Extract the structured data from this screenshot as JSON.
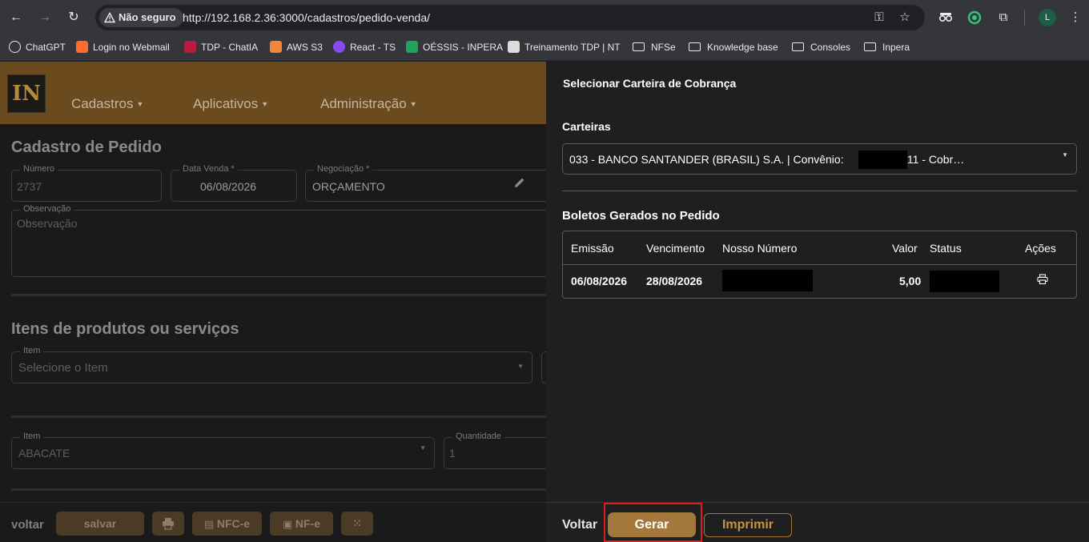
{
  "browser": {
    "security_label": "Não seguro",
    "url": "http://192.168.2.36:3000/cadastros/pedido-venda/",
    "profile_initial": "L",
    "bookmarks": [
      {
        "label": "ChatGPT",
        "icon": "chatgpt-icon",
        "color": "#e8eaed"
      },
      {
        "label": "Login no Webmail",
        "icon": "cpanel-icon",
        "color": "#ff6c2c"
      },
      {
        "label": "TDP - ChatIA",
        "icon": "tdp-icon",
        "color": "#b91c3c"
      },
      {
        "label": "AWS S3",
        "icon": "aws-icon",
        "color": "#f58536"
      },
      {
        "label": "React - TS",
        "icon": "react-icon",
        "color": "#8a4af3"
      },
      {
        "label": "OÉSSIS - INPERA",
        "icon": "oessis-icon",
        "color": "#1fa35a"
      },
      {
        "label": "Treinamento TDP | NT",
        "icon": "doc-icon",
        "color": "#dcdcdc"
      },
      {
        "label": "NFSe",
        "icon": "folder-icon"
      },
      {
        "label": "Knowledge base",
        "icon": "folder-icon"
      },
      {
        "label": "Consoles",
        "icon": "folder-icon"
      },
      {
        "label": "Inpera",
        "icon": "folder-icon"
      }
    ]
  },
  "app": {
    "logo_text": "IN",
    "menu": [
      "Cadastros",
      "Aplicativos",
      "Administração"
    ],
    "page_title": "Cadastro de Pedido",
    "fields": {
      "numero_label": "Número",
      "numero_value": "2737",
      "data_venda_label": "Data Venda *",
      "data_venda_value": "06/08/2026",
      "negociacao_label": "Negociação *",
      "negociacao_value": "ORÇAMENTO",
      "observacao_label": "Observação",
      "observacao_placeholder": "Observação"
    },
    "items_section_title": "Itens de produtos ou serviços",
    "item_select_label": "Item",
    "item_select_placeholder": "Selecione o Item",
    "item_row": {
      "item_label": "Item",
      "item_value": "ABACATE",
      "qty_label": "Quantidade",
      "qty_value": "1"
    },
    "footer": {
      "voltar": "voltar",
      "salvar": "salvar",
      "nfce": "NFC-e",
      "nfe": "NF-e"
    }
  },
  "drawer": {
    "title": "Selecionar Carteira de Cobrança",
    "carteiras_label": "Carteiras",
    "carteira_selected_prefix": "033 - BANCO SANTANDER (BRASIL) S.A. | Convênio:",
    "carteira_selected_suffix": "| 11 - Cobr…",
    "boletos_title": "Boletos Gerados no Pedido",
    "table": {
      "headers": [
        "Emissão",
        "Vencimento",
        "Nosso Número",
        "Valor",
        "Status",
        "Ações"
      ],
      "rows": [
        {
          "emissao": "06/08/2026",
          "vencimento": "28/08/2026",
          "valor": "5,00"
        }
      ]
    },
    "footer": {
      "voltar": "Voltar",
      "gerar": "Gerar",
      "imprimir": "Imprimir"
    },
    "colors": {
      "accent": "#a4773a",
      "highlight_frame": "#e11b1b"
    }
  }
}
